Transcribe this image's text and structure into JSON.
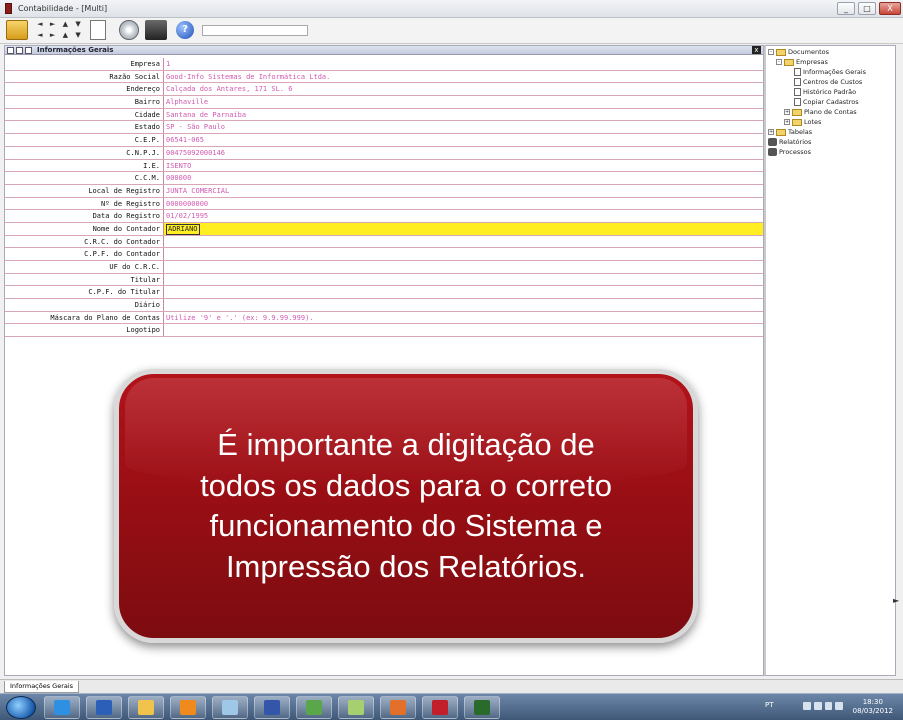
{
  "window": {
    "title": "Contabilidade - [Multi]",
    "controls": [
      "_",
      "□",
      "X"
    ]
  },
  "toolbar": {
    "nav_glyphs": [
      "◄",
      "►",
      "▲",
      "▼",
      "◄",
      "►",
      "▲",
      "▼"
    ],
    "help_glyph": "?"
  },
  "panel": {
    "title": "Informações Gerais",
    "close_glyph": "x"
  },
  "form": {
    "rows": [
      {
        "label": "Empresa",
        "value": "1"
      },
      {
        "label": "Razão Social",
        "value": "Good-Info Sistemas de Informática Ltda."
      },
      {
        "label": "Endereço",
        "value": "Calçada dos Antares, 171 SL. 6"
      },
      {
        "label": "Bairro",
        "value": "Alphaville"
      },
      {
        "label": "Cidade",
        "value": "Santana de Parnaíba"
      },
      {
        "label": "Estado",
        "value": "SP - São Paulo"
      },
      {
        "label": "C.E.P.",
        "value": "06541-065"
      },
      {
        "label": "C.N.P.J.",
        "value": "00475092000146"
      },
      {
        "label": "I.E.",
        "value": "ISENTO"
      },
      {
        "label": "C.C.M.",
        "value": "000000"
      },
      {
        "label": "Local de Registro",
        "value": "JUNTA COMERCIAL"
      },
      {
        "label": "Nº de Registro",
        "value": "0000000000"
      },
      {
        "label": "Data do Registro",
        "value": "01/02/1995"
      },
      {
        "label": "Nome do Contador",
        "value": "ADRIANO"
      },
      {
        "label": "C.R.C. do Contador",
        "value": ""
      },
      {
        "label": "C.P.F. do Contador",
        "value": ""
      },
      {
        "label": "UF do C.R.C.",
        "value": ""
      },
      {
        "label": "Titular",
        "value": ""
      },
      {
        "label": "C.P.F. do Titular",
        "value": ""
      },
      {
        "label": "Diário",
        "value": ""
      },
      {
        "label": "Máscara do Plano de Contas",
        "value": "Utilize '9' e '.' (ex: 9.9.99.999)."
      },
      {
        "label": "Logotipo",
        "value": ""
      }
    ],
    "active_row": 13
  },
  "callout": {
    "lines": [
      "É importante a digitação de",
      "todos os dados para o correto",
      "funcionamento do Sistema e",
      "Impressão dos Relatórios."
    ]
  },
  "tree": {
    "documentos": "Documentos",
    "empresas": "Empresas",
    "informacoes_gerais": "Informações Gerais",
    "centros_de_custos": "Centros de Custos",
    "historico_padrao": "Histórico Padrão",
    "copiar_cadastros": "Copiar Cadastros",
    "plano_de_contas": "Plano de Contas",
    "lotes": "Lotes",
    "tabelas": "Tabelas",
    "relatorios": "Relatórios",
    "processos": "Processos",
    "expand_glyph": "+",
    "collapse_glyph": "-"
  },
  "bottom_tab": {
    "label": "Informações Gerais"
  },
  "taskbar": {
    "language": "PT",
    "time": "18:30",
    "date": "08/03/2012",
    "apps": [
      {
        "name": "internet-explorer",
        "color": "#2f8fe0"
      },
      {
        "name": "word",
        "color": "#2b5fb8"
      },
      {
        "name": "file-explorer",
        "color": "#f0c44c"
      },
      {
        "name": "media-player",
        "color": "#f08a1c"
      },
      {
        "name": "notepad",
        "color": "#9fc7e8"
      },
      {
        "name": "network",
        "color": "#3355aa"
      },
      {
        "name": "app-green",
        "color": "#5aa64a"
      },
      {
        "name": "app-green-light",
        "color": "#a6d070"
      },
      {
        "name": "app-orange",
        "color": "#e2702a"
      },
      {
        "name": "app-red",
        "color": "#c21f2a"
      },
      {
        "name": "app-dark",
        "color": "#2a6a2a"
      }
    ]
  }
}
